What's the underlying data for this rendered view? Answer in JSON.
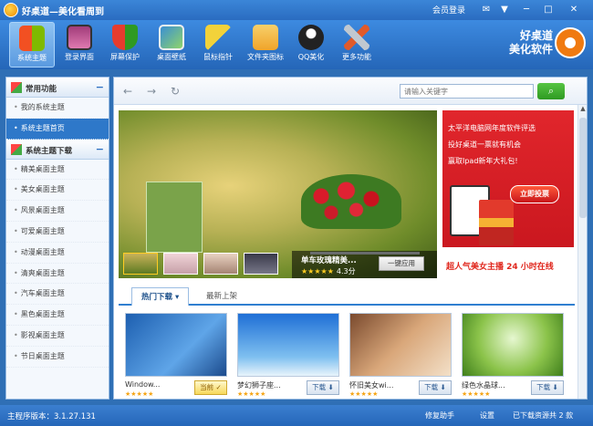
{
  "window": {
    "title": "好桌道—美化看周到",
    "member_login": "会员登录",
    "buttons": [
      "✉",
      "▼",
      "─",
      "□",
      "✕"
    ]
  },
  "toolbar": {
    "items": [
      {
        "label": "系统主题",
        "active": true,
        "color": "#2a72d8"
      },
      {
        "label": "登录界面",
        "active": false,
        "color": "#a13c7a"
      },
      {
        "label": "屏幕保护",
        "active": false,
        "color": "#e63c2e"
      },
      {
        "label": "桌面壁纸",
        "active": false,
        "color": "#3a8fd4"
      },
      {
        "label": "鼠标指针",
        "active": false,
        "color": "#f2d23a"
      },
      {
        "label": "文件夹图标",
        "active": false,
        "color": "#f0b43a"
      },
      {
        "label": "QQ美化",
        "active": false,
        "color": "#222222"
      },
      {
        "label": "更多功能",
        "active": false,
        "color": "#c0c8d0"
      }
    ],
    "logo": {
      "line1": "好桌道",
      "line2": "美化软件"
    }
  },
  "sidebar": {
    "section1": {
      "title": "常用功能",
      "toggle": "−"
    },
    "items1": [
      {
        "label": "我的系统主题",
        "selected": false
      },
      {
        "label": "系统主题首页",
        "selected": true
      }
    ],
    "section2": {
      "title": "系统主题下载",
      "toggle": "−"
    },
    "items2": [
      {
        "label": "精美桌面主题"
      },
      {
        "label": "美女桌面主题"
      },
      {
        "label": "风景桌面主题"
      },
      {
        "label": "可爱桌面主题"
      },
      {
        "label": "动漫桌面主题"
      },
      {
        "label": "清爽桌面主题"
      },
      {
        "label": "汽车桌面主题"
      },
      {
        "label": "黑色桌面主题"
      },
      {
        "label": "影视桌面主题"
      },
      {
        "label": "节日桌面主题"
      }
    ]
  },
  "nav": {
    "back": "←",
    "forward": "→",
    "refresh": "↻",
    "search_placeholder": "请输入关键字",
    "search_icon": "⌕"
  },
  "banner": {
    "caption": "单车玫瑰精美...",
    "stars": "★★★★★",
    "rating": "4.3分",
    "apply_label": "一键应用"
  },
  "ad": {
    "line1": "太平洋电脑网年度软件评选",
    "line2": "投好桌道一票就有机会",
    "line3": "赢取Ipad新年大礼包!",
    "vote": "立即投票",
    "bottom": "超人气美女主播 24 小时在线"
  },
  "tabs": [
    {
      "label": "热门下载 ▾",
      "active": true
    },
    {
      "label": "最新上架",
      "active": false
    }
  ],
  "cards": [
    {
      "name": "Window...",
      "stars": "★★★★★",
      "button": "当前 ✓",
      "current": true,
      "bg": "linear-gradient(135deg,#1d5fb0,#5fa5e8 60%,#1b4a8c)"
    },
    {
      "name": "梦幻狮子座...",
      "stars": "★★★★★",
      "button": "下载 ⬇",
      "current": false,
      "bg": "linear-gradient(#1f6fd6,#7fc0f0 70%,#e8f4fb)"
    },
    {
      "name": "怀旧美女wi...",
      "stars": "★★★★★",
      "button": "下载 ⬇",
      "current": false,
      "bg": "linear-gradient(135deg,#7a4a2e,#d9a77a 50%,#f3e0c8)"
    },
    {
      "name": "绿色水晶球...",
      "stars": "★★★★★",
      "button": "下载 ⬇",
      "current": false,
      "bg": "radial-gradient(circle at 50% 40%,#e6f7d0,#8bc34a 55%,#3f7f1c)"
    }
  ],
  "status": {
    "version": "主程序版本：3.1.27.131",
    "repair": "修复助手",
    "settings": "设置",
    "downloads": "已下载资源共 2 款"
  }
}
